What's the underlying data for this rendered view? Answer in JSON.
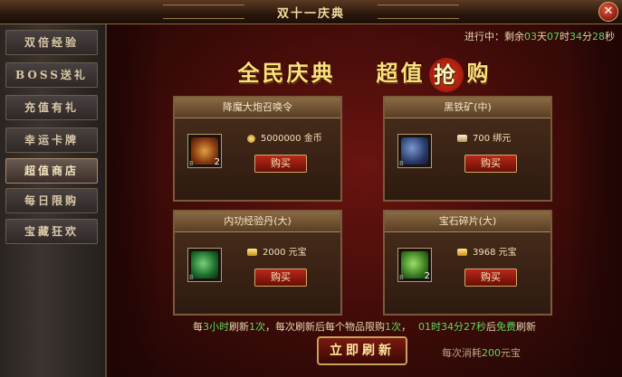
{
  "window": {
    "title": "双十一庆典",
    "close_label": "✕"
  },
  "sidebar": {
    "items": [
      {
        "label": "双倍经验"
      },
      {
        "label": "BOSS送礼"
      },
      {
        "label": "充值有礼"
      },
      {
        "label": "幸运卡牌"
      },
      {
        "label": "超值商店",
        "active": true
      },
      {
        "label": "每日限购"
      },
      {
        "label": "宝藏狂欢"
      }
    ]
  },
  "timer": {
    "prefix": "进行中：剩余",
    "d": "03",
    "t1": "天",
    "h": "07",
    "t2": "时",
    "m": "34",
    "t3": "分",
    "s": "28",
    "t4": "秒"
  },
  "banner": {
    "left": "全民庆典",
    "right_pre": "超值",
    "grab": "抢",
    "right_post": "购"
  },
  "cards": [
    {
      "title": "降魔大炮召唤令",
      "price": "5000000",
      "currency": "金币",
      "currency_icon": "gold-coin-icon",
      "item_icon": "summon-token-icon",
      "count": "2",
      "buy": "购买"
    },
    {
      "title": "黑铁矿(中)",
      "price": "700",
      "currency": "绑元",
      "currency_icon": "bound-ingot-icon",
      "item_icon": "black-iron-ore-icon",
      "count": "",
      "buy": "购买"
    },
    {
      "title": "内功经验丹(大)",
      "price": "2000",
      "currency": "元宝",
      "currency_icon": "ingot-icon",
      "item_icon": "exp-pill-icon",
      "count": "",
      "buy": "购买"
    },
    {
      "title": "宝石碎片(大)",
      "price": "3968",
      "currency": "元宝",
      "currency_icon": "ingot-icon",
      "item_icon": "gem-shard-icon",
      "count": "2",
      "buy": "购买"
    }
  ],
  "footer": {
    "p1": "每",
    "hours": "3小时",
    "p2": "刷新",
    "times": "1次",
    "p3": "，每次刷新后每个物品限购",
    "limit": "1次",
    "p4": "，",
    "countdown": "01时34分27秒",
    "p5": "后",
    "free": "免费",
    "p6": "刷新"
  },
  "refresh_button": "立即刷新",
  "cost_note": {
    "pre": "每次消耗",
    "amount": "200",
    "post": "元宝"
  },
  "colors": {
    "accent_green": "#5bdb5b",
    "gold": "#ffdf7a",
    "button_red": "#b8281a"
  }
}
